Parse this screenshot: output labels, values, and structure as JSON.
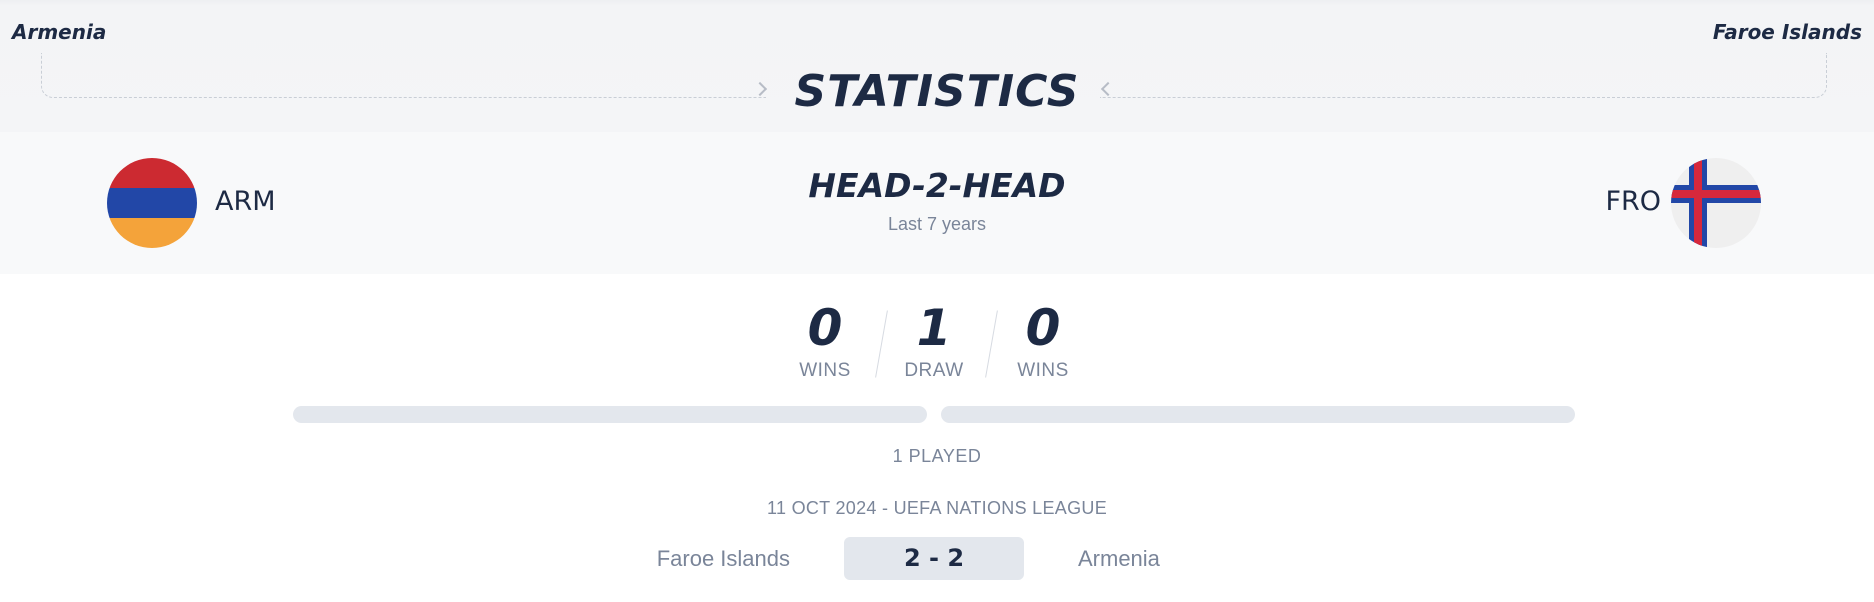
{
  "header": {
    "home_team": "Armenia",
    "away_team": "Faroe Islands",
    "title": "STATISTICS"
  },
  "head_to_head": {
    "title": "HEAD-2-HEAD",
    "period": "Last 7 years",
    "home_code": "ARM",
    "away_code": "FRO",
    "home_wins": "0",
    "home_wins_label": "WINS",
    "draws": "1",
    "draws_label": "DRAW",
    "away_wins": "0",
    "away_wins_label": "WINS",
    "home_win_share": 0,
    "away_win_share": 0,
    "played": "1 PLAYED"
  },
  "matches": [
    {
      "info": "11 OCT 2024 - UEFA NATIONS LEAGUE",
      "home": "Faroe Islands",
      "score": "2 - 2",
      "away": "Armenia"
    }
  ],
  "icons": {
    "home_flag": "armenia-flag-icon",
    "away_flag": "faroe-islands-flag-icon"
  },
  "colors": {
    "text_dark": "#1d2a44",
    "text_muted": "#7a8599",
    "bar_track": "#e3e7ed",
    "armenia_red": "#cc2a31",
    "armenia_blue": "#2247a7",
    "armenia_orange": "#f4a33a",
    "faroe_red": "#d6283c",
    "faroe_blue": "#2247a7"
  }
}
